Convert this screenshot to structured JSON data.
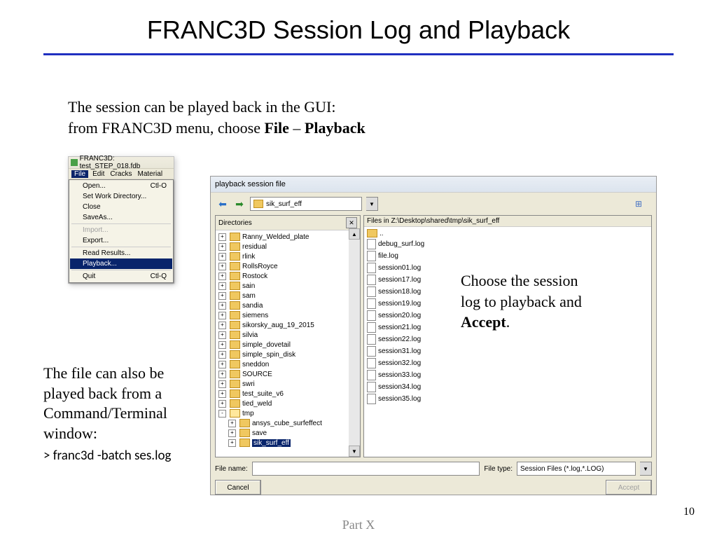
{
  "title": "FRANC3D Session Log and Playback",
  "intro_line1": "The session can be played back in the GUI:",
  "intro_line2a": "from FRANC3D menu, choose ",
  "intro_line2b": "File",
  "intro_line2c": " – ",
  "intro_line2d": "Playback",
  "menu_shot": {
    "title": "FRANC3D:  test_STEP_018.fdb",
    "menubar": {
      "file": "File",
      "edit": "Edit",
      "cracks": "Cracks",
      "material": "Material"
    },
    "items": [
      {
        "label": "Open...",
        "accel": "Ctl-O"
      },
      {
        "label": "Set Work Directory..."
      },
      {
        "label": "Close"
      },
      {
        "label": "SaveAs..."
      },
      {
        "sep": true
      },
      {
        "label": "Import...",
        "disabled": true
      },
      {
        "label": "Export..."
      },
      {
        "sep": true
      },
      {
        "label": "Read Results..."
      },
      {
        "label": "Playback...",
        "selected": true
      },
      {
        "sep": true
      },
      {
        "label": "Quit",
        "accel": "Ctl-Q"
      }
    ]
  },
  "dialog": {
    "title": "playback session file",
    "path": "sik_surf_eff",
    "left_header": "Directories",
    "right_header": "Files in Z:\\Desktop\\shared\\tmp\\sik_surf_eff",
    "tree": [
      {
        "lvl": 0,
        "ex": "+",
        "label": "Ranny_Welded_plate"
      },
      {
        "lvl": 0,
        "ex": "+",
        "label": "residual"
      },
      {
        "lvl": 0,
        "ex": "+",
        "label": "rlink"
      },
      {
        "lvl": 0,
        "ex": "+",
        "label": "RollsRoyce"
      },
      {
        "lvl": 0,
        "ex": "+",
        "label": "Rostock"
      },
      {
        "lvl": 0,
        "ex": "+",
        "label": "sain"
      },
      {
        "lvl": 0,
        "ex": "+",
        "label": "sam"
      },
      {
        "lvl": 0,
        "ex": "+",
        "label": "sandia"
      },
      {
        "lvl": 0,
        "ex": "+",
        "label": "siemens"
      },
      {
        "lvl": 0,
        "ex": "+",
        "label": "sikorsky_aug_19_2015"
      },
      {
        "lvl": 0,
        "ex": "+",
        "label": "silvia"
      },
      {
        "lvl": 0,
        "ex": "+",
        "label": "simple_dovetail"
      },
      {
        "lvl": 0,
        "ex": "+",
        "label": "simple_spin_disk"
      },
      {
        "lvl": 0,
        "ex": "+",
        "label": "sneddon"
      },
      {
        "lvl": 0,
        "ex": "+",
        "label": "SOURCE"
      },
      {
        "lvl": 0,
        "ex": "+",
        "label": "swri"
      },
      {
        "lvl": 0,
        "ex": "+",
        "label": "test_suite_v6"
      },
      {
        "lvl": 0,
        "ex": "+",
        "label": "tied_weld"
      },
      {
        "lvl": 0,
        "ex": "-",
        "label": "tmp",
        "open": true
      },
      {
        "lvl": 1,
        "ex": "+",
        "label": "ansys_cube_surfeffect"
      },
      {
        "lvl": 1,
        "ex": "+",
        "label": "save"
      },
      {
        "lvl": 1,
        "ex": "+",
        "label": "sik_surf_eff",
        "sel": true
      }
    ],
    "files": [
      {
        "up": true,
        "label": ".."
      },
      {
        "label": "debug_surf.log"
      },
      {
        "label": "file.log"
      },
      {
        "label": "session01.log"
      },
      {
        "label": "session17.log"
      },
      {
        "label": "session18.log"
      },
      {
        "label": "session19.log"
      },
      {
        "label": "session20.log"
      },
      {
        "label": "session21.log"
      },
      {
        "label": "session22.log"
      },
      {
        "label": "session31.log"
      },
      {
        "label": "session32.log"
      },
      {
        "label": "session33.log"
      },
      {
        "label": "session34.log"
      },
      {
        "label": "session35.log"
      }
    ],
    "filename_label": "File name:",
    "filetype_label": "File type:",
    "filetype_value": "Session Files (*.log,*.LOG)",
    "cancel": "Cancel",
    "accept": "Accept"
  },
  "callout_a": "Choose the session log to playback and ",
  "callout_b": "Accept",
  "callout_c": ".",
  "bottom_text": "The file can also be played back from a Command/Terminal window:",
  "cmd": "> franc3d -batch ses.log",
  "page_num": "10",
  "part": "Part X"
}
